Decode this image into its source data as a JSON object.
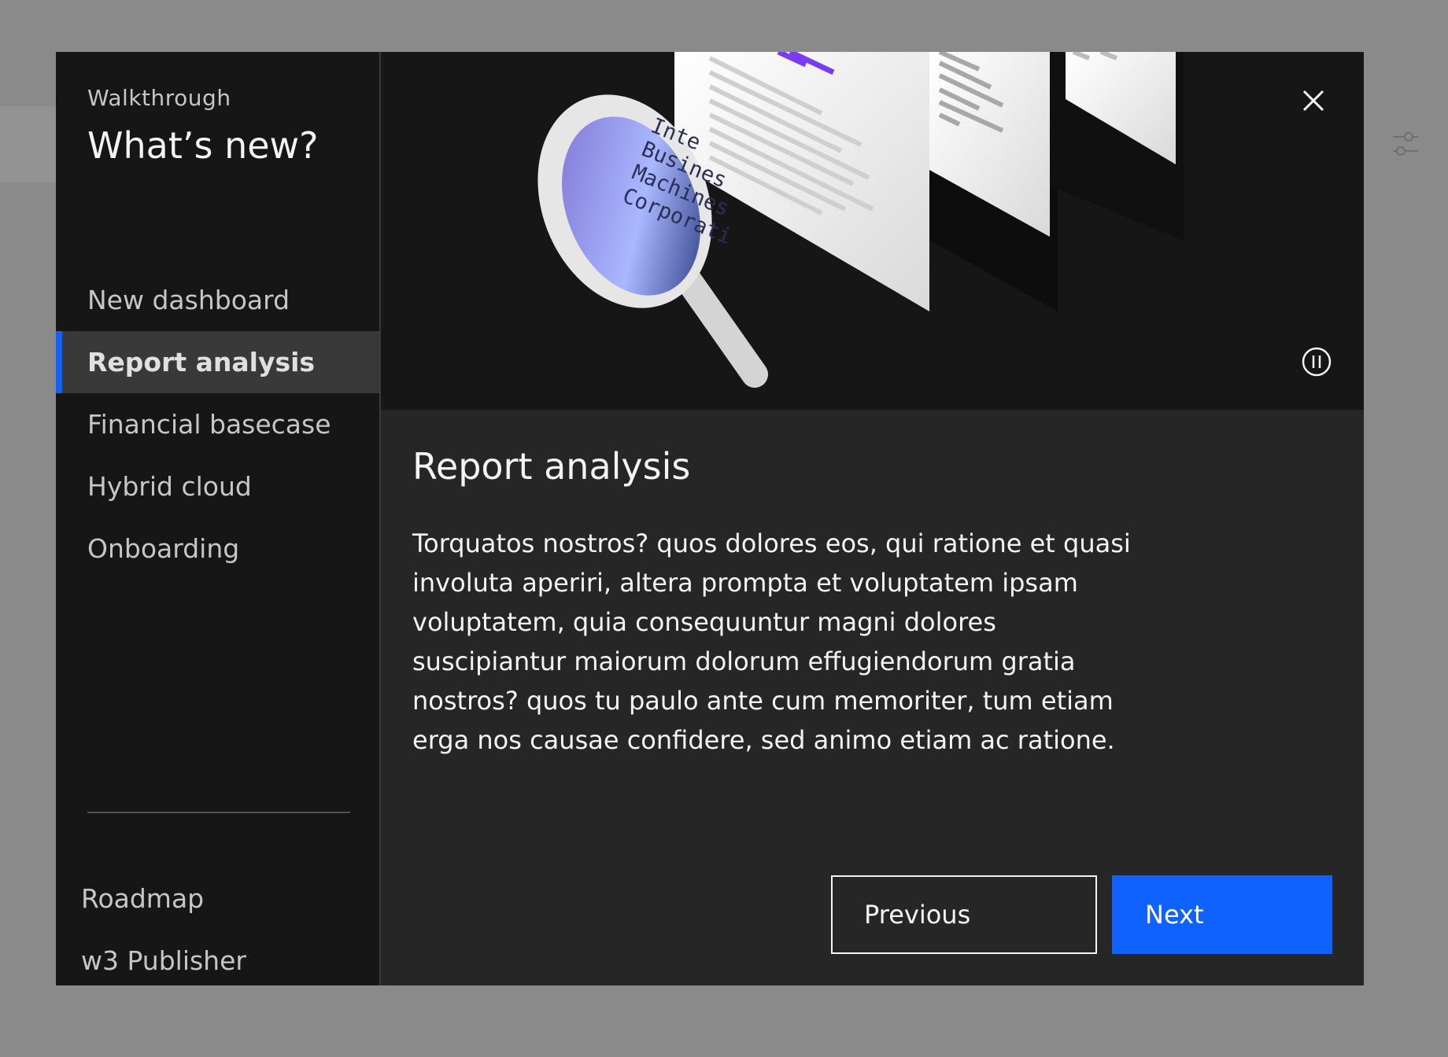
{
  "colors": {
    "overlay": "#8a8a8a",
    "sidebar_bg": "#161616",
    "panel_bg": "#262626",
    "active_bg": "#393939",
    "accent": "#0f62fe",
    "text_primary": "#f4f4f4",
    "text_secondary": "#c6c6c6",
    "magnifier_lens": "#8a7fd6"
  },
  "sidebar": {
    "eyebrow": "Walkthrough",
    "title": "What’s new?",
    "items": [
      {
        "label": "New dashboard",
        "active": false
      },
      {
        "label": "Report analysis",
        "active": true
      },
      {
        "label": "Financial basecase",
        "active": false
      },
      {
        "label": "Hybrid cloud",
        "active": false
      },
      {
        "label": "Onboarding",
        "active": false
      }
    ],
    "footer_links": [
      {
        "label": "Roadmap"
      },
      {
        "label": "w3 Publisher"
      }
    ]
  },
  "hero": {
    "illustration": "magnifying-glass-over-documents",
    "lens_text": [
      "Inte",
      "Busines",
      "Machines",
      "Corporati"
    ],
    "close_icon": "close-icon",
    "pause_icon": "pause-icon"
  },
  "content": {
    "title": "Report analysis",
    "body": "Torquatos nostros? quos dolores eos, qui ratione et quasi involuta aperiri, altera prompta et voluptatem ipsam voluptatem, quia consequuntur magni dolores suscipiantur maiorum dolorum effugiendorum gratia nostros? quos tu paulo ante cum memoriter, tum etiam erga nos causae confidere, sed animo etiam ac ratione."
  },
  "actions": {
    "previous_label": "Previous",
    "next_label": "Next"
  },
  "background": {
    "settings_icon": "sliders-icon"
  }
}
